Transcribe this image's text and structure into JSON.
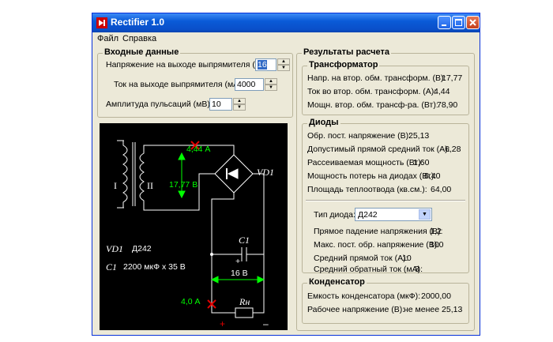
{
  "window": {
    "title": "Rectifier 1.0"
  },
  "menu": [
    "Файл",
    "Справка"
  ],
  "input": {
    "title": "Входные данные",
    "voltage_label": "Напряжение на выходе выпрямителя (В):",
    "voltage_value": "16",
    "current_label": "Ток на выходе выпрямителя (мА):",
    "current_value": "4000",
    "ripple_label": "Амплитуда пульсаций (мВ):",
    "ripple_value": "10"
  },
  "schematic": {
    "current_top": "4,44 А",
    "voltage_secondary": "17,77 В",
    "winding_primary": "I",
    "winding_secondary": "II",
    "bridge_label": "VD1",
    "capacitor_label": "C1",
    "vd_desc_name": "VD1",
    "vd_desc_value": "Д242",
    "c_desc_name": "C1",
    "c_desc_value": "2200 мкФ х 35 В",
    "voltage_load": "16 В",
    "current_load": "4,0 А",
    "load_label": "Rн",
    "plus": "+",
    "minus": "–",
    "cap_plus": "+"
  },
  "results": {
    "title": "Результаты расчета",
    "transformer": {
      "title": "Трансформатор",
      "rows": [
        {
          "label": "Напр. на втор. обм. трансформ. (В):",
          "value": "17,77"
        },
        {
          "label": "Ток во втор. обм. трансформ. (А):",
          "value": "4,44"
        },
        {
          "label": "Мощн. втор. обм. трансф-ра. (Вт):",
          "value": "78,90"
        }
      ]
    },
    "diodes": {
      "title": "Диоды",
      "rows": [
        {
          "label": "Обр. пост. напряжение (В):",
          "value": "25,13"
        },
        {
          "label": "Допустимый прямой средний ток (А):",
          "value": "6,28"
        },
        {
          "label": "Рассеиваемая мощность (Вт):",
          "value": "1,60"
        },
        {
          "label": "Мощность потерь на диодах (Вт):",
          "value": "6,40"
        },
        {
          "label": "Площадь теплоотвода (кв.см.):",
          "value": "64,00"
        }
      ],
      "type_label": "Тип диода:",
      "type_value": "Д242",
      "spec_rows": [
        {
          "label": "Прямое падение напряжения (В):",
          "value": "1,2"
        },
        {
          "label": "Макс. пост. обр. напряжение (В):",
          "value": "100"
        },
        {
          "label": "Средний прямой ток (А):",
          "value": "10"
        },
        {
          "label": "Средний обратный ток (мА):",
          "value": "3"
        }
      ]
    },
    "capacitor": {
      "title": "Конденсатор",
      "rows": [
        {
          "label": "Емкость конденсатора (мкФ):",
          "value": "2000,00"
        },
        {
          "label": "Рабочее напряжение (В):",
          "value": "не менее 25,13"
        }
      ]
    }
  }
}
